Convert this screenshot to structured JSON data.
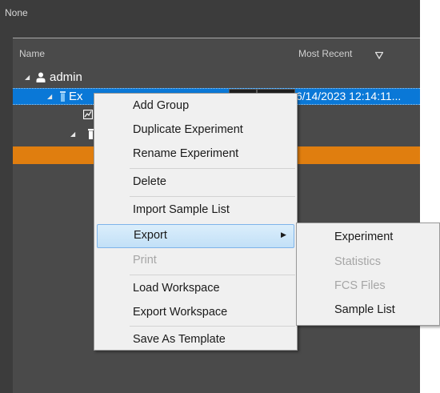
{
  "top_label": "None",
  "columns": {
    "name": "Name",
    "most_recent": "Most Recent"
  },
  "tree": {
    "user_label": "admin",
    "experiment_label_visible": "Ex",
    "experiment_date": "6/14/2023 12:14:11..."
  },
  "colors": {
    "selection": "#0a78d7",
    "orange_row": "#e07e0f",
    "background": "#3c3c3c"
  },
  "icons": [
    "sort-filter-icon",
    "person-icon",
    "tube-icon",
    "chart-icon",
    "expander-icon",
    "submenu-arrow-icon"
  ],
  "context_menu": {
    "items": [
      {
        "label": "Add Group",
        "enabled": true
      },
      {
        "label": "Duplicate Experiment",
        "enabled": true
      },
      {
        "label": "Rename Experiment",
        "enabled": true
      },
      {
        "label": "Delete",
        "enabled": true
      },
      {
        "label": "Import Sample List",
        "enabled": true
      },
      {
        "label": "Export",
        "enabled": true,
        "highlighted": true,
        "has_submenu": true
      },
      {
        "label": "Print",
        "enabled": false
      },
      {
        "label": "Load Workspace",
        "enabled": true
      },
      {
        "label": "Export Workspace",
        "enabled": true
      },
      {
        "label": "Save As Template",
        "enabled": true
      }
    ]
  },
  "export_submenu": {
    "items": [
      {
        "label": "Experiment",
        "enabled": true
      },
      {
        "label": "Statistics",
        "enabled": false
      },
      {
        "label": "FCS Files",
        "enabled": false
      },
      {
        "label": "Sample List",
        "enabled": true
      }
    ]
  }
}
